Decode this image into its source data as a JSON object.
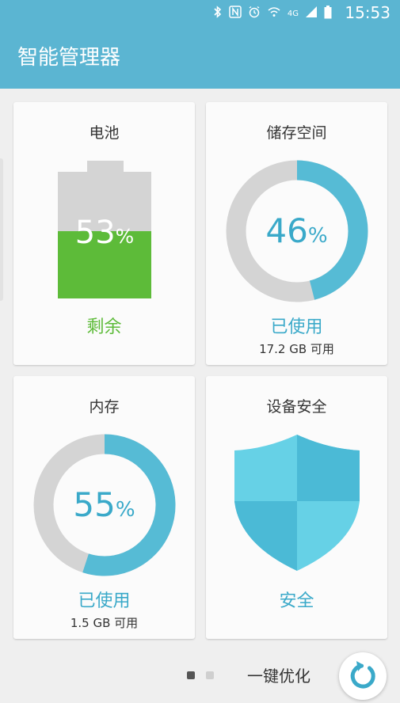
{
  "status_bar": {
    "time": "15:53",
    "network": "4G",
    "icons": [
      "bluetooth-icon",
      "nfc-icon",
      "alarm-icon",
      "wifi-icon",
      "signal-icon",
      "battery-icon"
    ]
  },
  "app": {
    "title": "智能管理器"
  },
  "colors": {
    "accent": "#5bb5d2",
    "ring": "#3aa9c9",
    "battery_green": "#5dbb39",
    "track": "#d4d4d4"
  },
  "cards": {
    "battery": {
      "title": "电池",
      "percent": "53",
      "percent_sign": "%",
      "level": 53,
      "status": "剩余"
    },
    "storage": {
      "title": "储存空间",
      "percent": "46",
      "percent_sign": "%",
      "level": 46,
      "status": "已使用",
      "detail": "17.2 GB 可用"
    },
    "memory": {
      "title": "内存",
      "percent": "55",
      "percent_sign": "%",
      "level": 55,
      "status": "已使用",
      "detail": "1.5 GB 可用"
    },
    "security": {
      "title": "设备安全",
      "status": "安全"
    }
  },
  "bottom": {
    "optimize_label": "一键优化",
    "page_index": 1,
    "page_count": 2
  }
}
